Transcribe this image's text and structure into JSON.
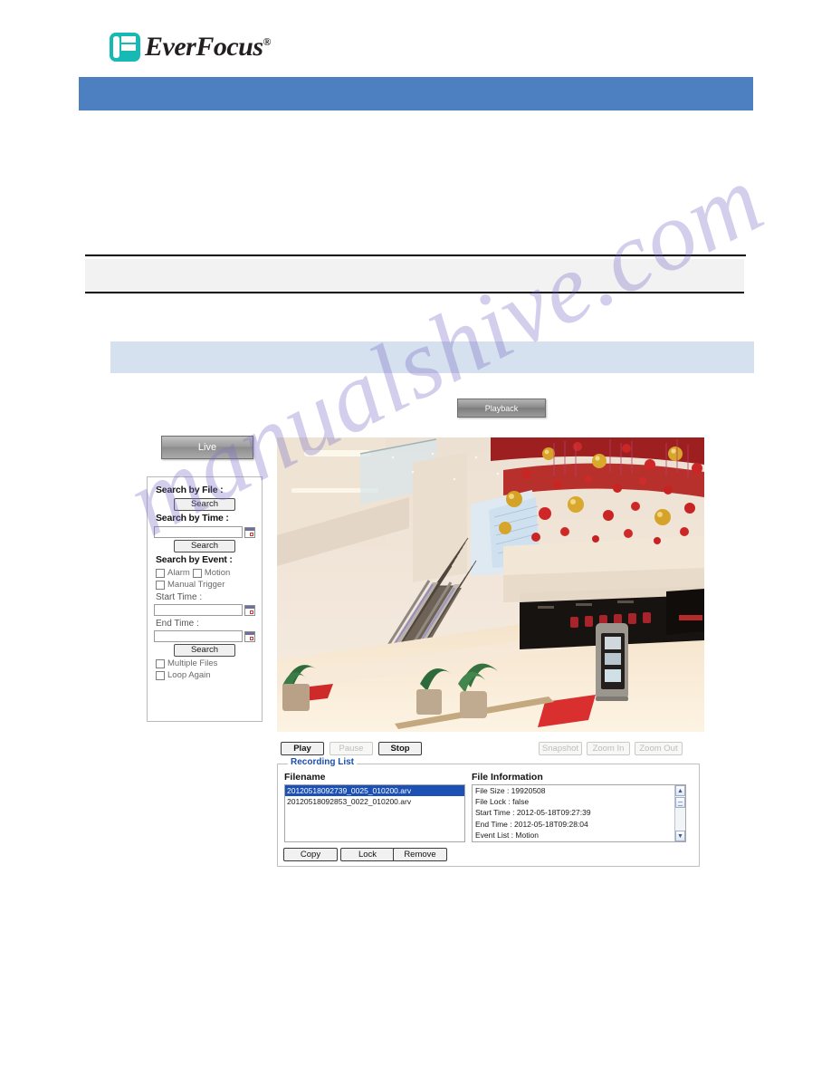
{
  "brand": {
    "name": "EverFocus",
    "registered": "®",
    "logo_icon": "everfocus-f-logo-icon",
    "accent": "#17b9b5",
    "header_bar_color": "#4d80c0",
    "section_bar_color": "#d6e1ef"
  },
  "watermark": {
    "text": "manualshive.com",
    "color": "#7c70c4"
  },
  "tabs": {
    "playback_label": "Playback",
    "live_label": "Live"
  },
  "search_panel": {
    "search_by_file_label": "Search by File :",
    "search_by_file_button": "Search",
    "search_by_time_label": "Search by Time :",
    "search_by_time_value": "",
    "search_by_time_button": "Search",
    "search_by_event_label": "Search by Event :",
    "alarm_label": "Alarm",
    "motion_label": "Motion",
    "manual_trigger_label": "Manual Trigger",
    "start_time_label": "Start Time :",
    "start_time_value": "",
    "end_time_label": "End Time :",
    "end_time_value": "",
    "search_by_event_button": "Search",
    "multiple_files_label": "Multiple Files",
    "loop_again_label": "Loop Again"
  },
  "video": {
    "description": "Shopping mall interior with escalators and red and gold hanging decorations"
  },
  "controls": {
    "play": "Play",
    "pause": "Pause",
    "stop": "Stop",
    "snapshot": "Snapshot",
    "zoom_in": "Zoom In",
    "zoom_out": "Zoom Out"
  },
  "recording_list": {
    "legend": "Recording List",
    "filename_header": "Filename",
    "file_information_header": "File Information",
    "files": [
      {
        "name": "20120518092739_0025_010200.arv",
        "selected": true
      },
      {
        "name": "20120518092853_0022_010200.arv",
        "selected": false
      }
    ],
    "file_information": [
      "File Size : 19920508",
      "File Lock : false",
      "Start Time : 2012-05-18T09:27:39",
      "End Time : 2012-05-18T09:28:04",
      "Event List : Motion"
    ],
    "copy_button": "Copy",
    "lock_button": "Lock",
    "remove_button": "Remove"
  }
}
